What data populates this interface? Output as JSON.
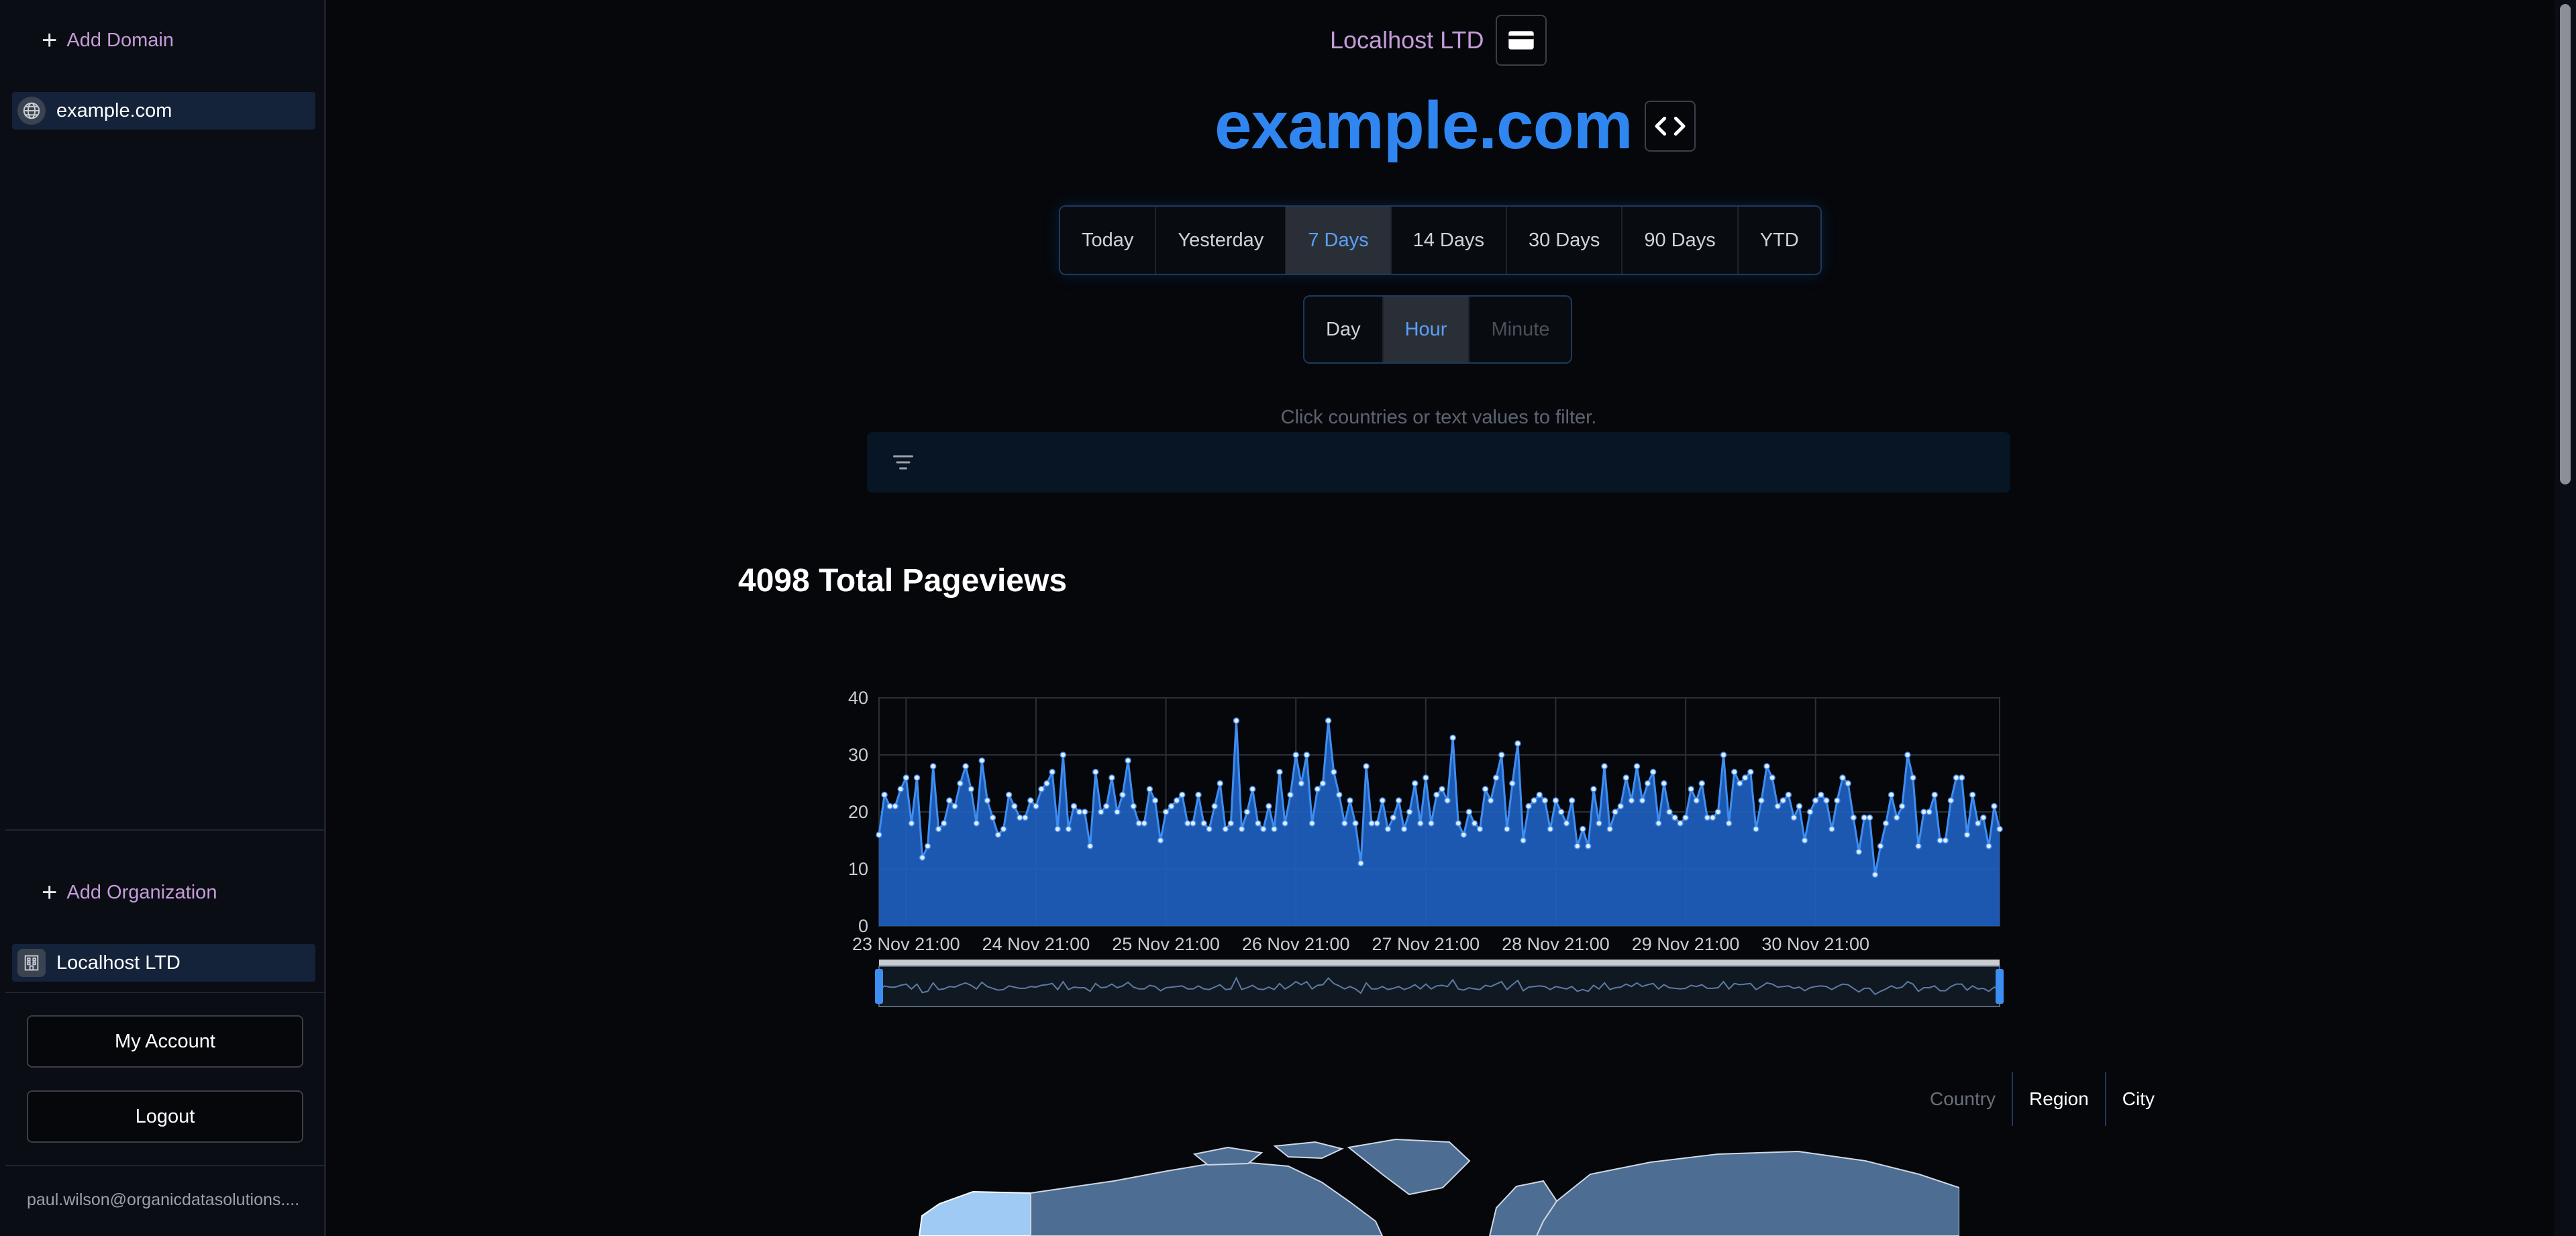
{
  "sidebar": {
    "add_domain": "Add Domain",
    "domain_item": "example.com",
    "add_organization": "Add Organization",
    "organization_item": "Localhost LTD",
    "my_account": "My Account",
    "logout": "Logout",
    "email": "paul.wilson@organicdatasolutions...."
  },
  "header": {
    "org_name": "Localhost LTD",
    "domain_title": "example.com",
    "billing_icon": "credit-card-icon",
    "embed_icon": "code-icon"
  },
  "ranges": [
    "Today",
    "Yesterday",
    "7 Days",
    "14 Days",
    "30 Days",
    "90 Days",
    "YTD"
  ],
  "active_range": "7 Days",
  "granularity": [
    "Day",
    "Hour",
    "Minute"
  ],
  "active_granularity": "Hour",
  "filter": {
    "hint": "Click countries or text values to filter."
  },
  "main": {
    "total_title": "4098 Total Pageviews"
  },
  "geo_tabs": [
    "Country",
    "Region",
    "City"
  ],
  "colors": {
    "accent": "#2f86f0",
    "series": "#2468c8",
    "org": "#c59bd8"
  },
  "chart_data": {
    "type": "area",
    "title": "",
    "xlabel": "",
    "ylabel": "",
    "ylim": [
      0,
      40
    ],
    "yticks": [
      0,
      10,
      20,
      30,
      40
    ],
    "x_tick_labels": [
      "23 Nov 21:00",
      "24 Nov 21:00",
      "25 Nov 21:00",
      "26 Nov 21:00",
      "27 Nov 21:00",
      "28 Nov 21:00",
      "29 Nov 21:00",
      "30 Nov 21:00"
    ],
    "series": [
      {
        "values": [
          16,
          23,
          21,
          21,
          24,
          26,
          18,
          26,
          12,
          14,
          28,
          17,
          18,
          22,
          21,
          25,
          28,
          24,
          18,
          29,
          22,
          19,
          16,
          17,
          23,
          21,
          19,
          19,
          22,
          21,
          24,
          25,
          27,
          17,
          30,
          17,
          21,
          20,
          20,
          14,
          27,
          20,
          21,
          26,
          20,
          23,
          29,
          21,
          18,
          18,
          24,
          22,
          15,
          20,
          21,
          22,
          23,
          18,
          18,
          23,
          18,
          17,
          21,
          25,
          17,
          18,
          36,
          17,
          20,
          24,
          18,
          17,
          21,
          17,
          27,
          18,
          23,
          30,
          25,
          30,
          18,
          24,
          25,
          36,
          27,
          23,
          18,
          22,
          18,
          11,
          28,
          18,
          18,
          22,
          17,
          19,
          22,
          17,
          20,
          25,
          18,
          26,
          18,
          23,
          24,
          22,
          33,
          18,
          16,
          20,
          18,
          17,
          24,
          22,
          26,
          30,
          17,
          25,
          32,
          15,
          21,
          22,
          23,
          22,
          17,
          22,
          20,
          18,
          22,
          14,
          17,
          14,
          24,
          18,
          28,
          17,
          20,
          21,
          26,
          22,
          28,
          22,
          25,
          27,
          18,
          25,
          20,
          19,
          18,
          19,
          24,
          22,
          25,
          19,
          19,
          20,
          30,
          18,
          27,
          25,
          26,
          27,
          17,
          22,
          28,
          26,
          21,
          22,
          23,
          19,
          21,
          15,
          20,
          22,
          23,
          22,
          17,
          22,
          26,
          25,
          19,
          13,
          19,
          19,
          9,
          14,
          18,
          23,
          19,
          21,
          30,
          26,
          14,
          20,
          20,
          23,
          15,
          15,
          22,
          26,
          26,
          16,
          23,
          18,
          19,
          14,
          21,
          17
        ]
      }
    ]
  }
}
